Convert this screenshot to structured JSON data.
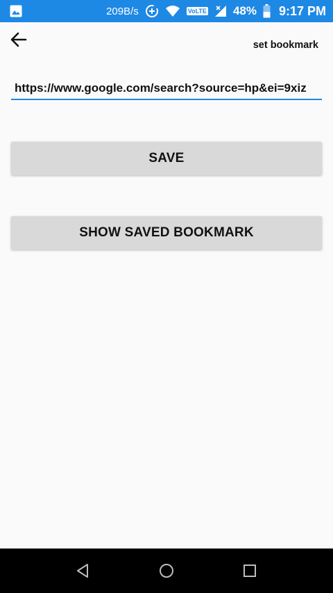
{
  "status_bar": {
    "net_speed": "209B/s",
    "volte": "VoLTE",
    "battery_percent": "48%",
    "time": "9:17 PM",
    "icons": [
      "image-notification-icon",
      "data-saver-icon",
      "wifi-icon",
      "volte-icon",
      "signal-icon",
      "battery-icon"
    ]
  },
  "app_bar": {
    "back_icon": "arrow-left-icon",
    "action_label": "set bookmark"
  },
  "url_field": {
    "value": "https://www.google.com/search?source=hp&ei=9xiz"
  },
  "buttons": {
    "save_label": "SAVE",
    "show_saved_label": "SHOW SAVED BOOKMARK"
  },
  "nav_bar": {
    "icons": [
      "nav-back-icon",
      "nav-home-icon",
      "nav-recents-icon"
    ]
  },
  "colors": {
    "status_bar": "#1e88e5",
    "accent": "#1e88e5",
    "button_bg": "#d9d9d9",
    "background": "#fafafa",
    "nav_bar": "#000000"
  }
}
